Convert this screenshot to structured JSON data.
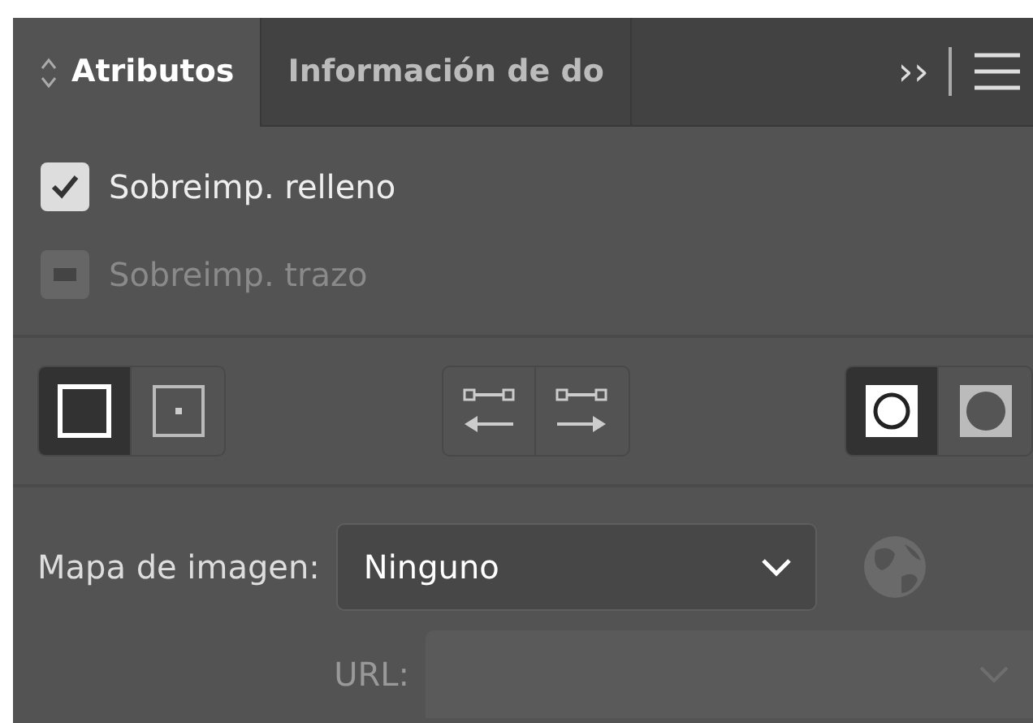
{
  "tabs": [
    {
      "label": "Atributos",
      "selected": true
    },
    {
      "label": "Información de do",
      "selected": false
    }
  ],
  "overflow_label": "››",
  "checkboxes": [
    {
      "label": "Sobreimp. relleno",
      "checked": true,
      "mixed": false,
      "disabled": false
    },
    {
      "label": "Sobreimp. trazo",
      "checked": false,
      "mixed": true,
      "disabled": true
    }
  ],
  "button_groups": [
    [
      {
        "kind": "square",
        "selected": true
      },
      {
        "kind": "dot",
        "selected": false
      }
    ],
    [
      {
        "kind": "left",
        "selected": false
      },
      {
        "kind": "right",
        "selected": false
      }
    ],
    [
      {
        "kind": "ring",
        "selected": true
      },
      {
        "kind": "disc",
        "selected": false
      }
    ]
  ],
  "image_map": {
    "label": "Mapa de imagen:",
    "value": "Ninguno"
  },
  "url": {
    "label": "URL:",
    "disabled": true
  }
}
